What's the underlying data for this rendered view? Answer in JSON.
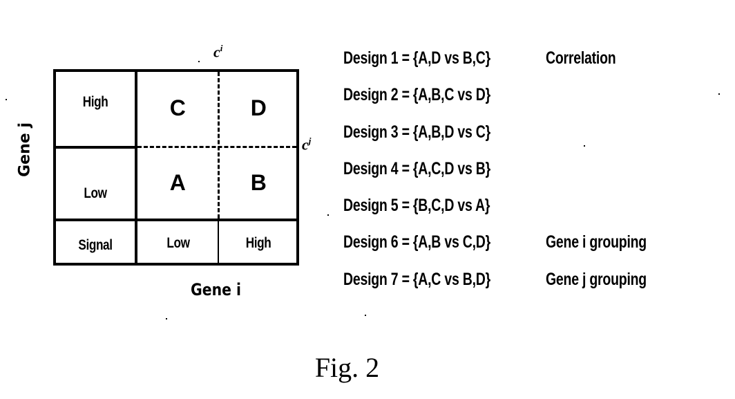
{
  "figure": {
    "caption": "Fig. 2"
  },
  "grid": {
    "axis_x_label": "Gene i",
    "axis_y_label": "Gene j",
    "threshold_x": {
      "base": "c",
      "sup": "i"
    },
    "threshold_y": {
      "base": "c",
      "sup": "j"
    },
    "row_headers": [
      "High",
      "Low"
    ],
    "signal_header": "Signal",
    "column_headers": [
      "Low",
      "High"
    ],
    "cells": {
      "top_left": "C",
      "top_right": "D",
      "bottom_left": "A",
      "bottom_right": "B"
    }
  },
  "designs": [
    {
      "definition": "Design 1 = {A,D vs B,C}",
      "note": "Correlation"
    },
    {
      "definition": "Design 2 = {A,B,C vs D}",
      "note": ""
    },
    {
      "definition": "Design 3 = {A,B,D vs C}",
      "note": ""
    },
    {
      "definition": "Design 4 = {A,C,D vs B}",
      "note": ""
    },
    {
      "definition": "Design 5 = {B,C,D vs A}",
      "note": ""
    },
    {
      "definition": "Design 6 = {A,B vs C,D}",
      "note": "Gene i grouping"
    },
    {
      "definition": "Design 7 = {A,C vs B,D}",
      "note": "Gene j grouping"
    }
  ]
}
